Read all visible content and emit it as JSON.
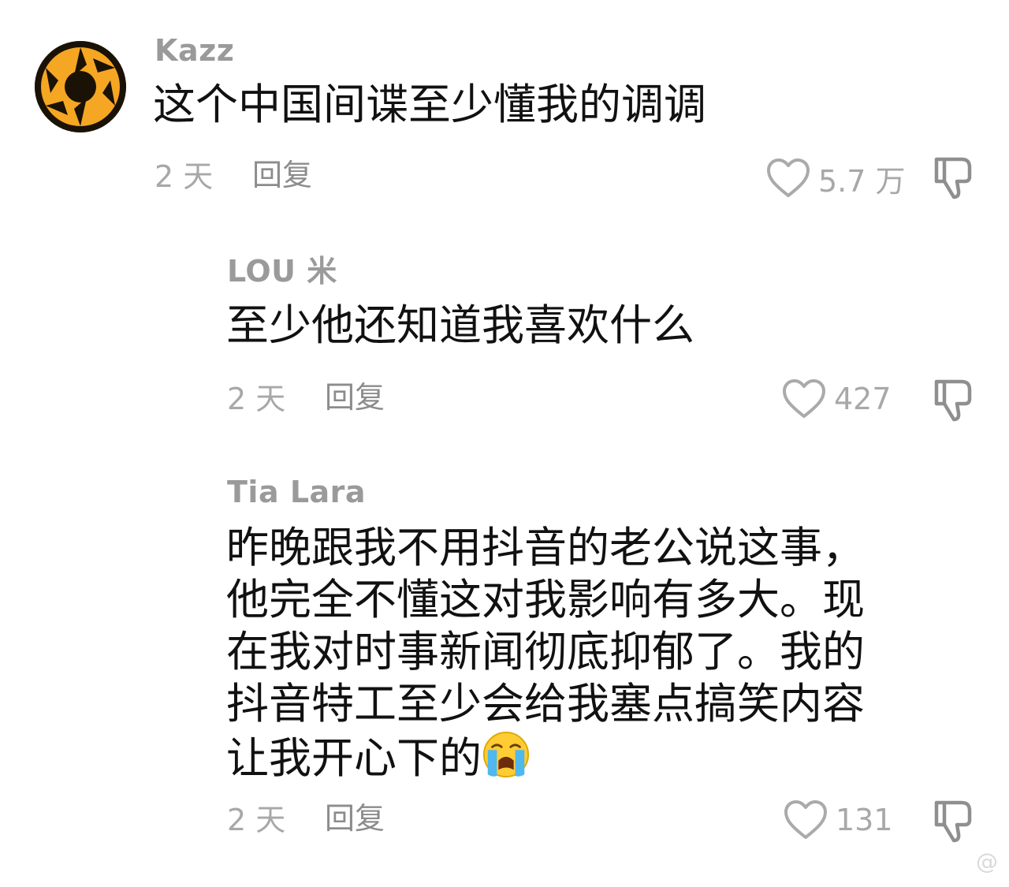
{
  "comments": [
    {
      "username": "Kazz",
      "text_lines": [
        "这个中国间谍至少懂我的调调"
      ],
      "time": "2 天",
      "reply_label": "回复",
      "likes": "5.7 万"
    },
    {
      "username": "LOU ⽶",
      "text_lines": [
        "至少他还知道我喜欢什么"
      ],
      "time": "2 天",
      "reply_label": "回复",
      "likes": "427"
    },
    {
      "username": "Tia Lara",
      "text_lines": [
        "昨晚跟我不用抖音的老公说这事，",
        "他完全不懂这对我影响有多大。现",
        "在我对时事新闻彻底抑郁了。我的",
        "抖音特工至少会给我塞点搞笑内容",
        "让我开心下的"
      ],
      "time": "2 天",
      "reply_label": "回复",
      "likes": "131"
    }
  ],
  "icons": {
    "avatar": "aperture-logo-icon",
    "like": "heart-outline-icon",
    "dislike": "thumbs-down-icon",
    "emoji": "loudly-crying-face-emoji"
  },
  "colors": {
    "username": "#9a9a9a",
    "meta": "#a8a8a8",
    "text": "#111111",
    "avatar_orange": "#f5a623"
  },
  "watermark": "@"
}
